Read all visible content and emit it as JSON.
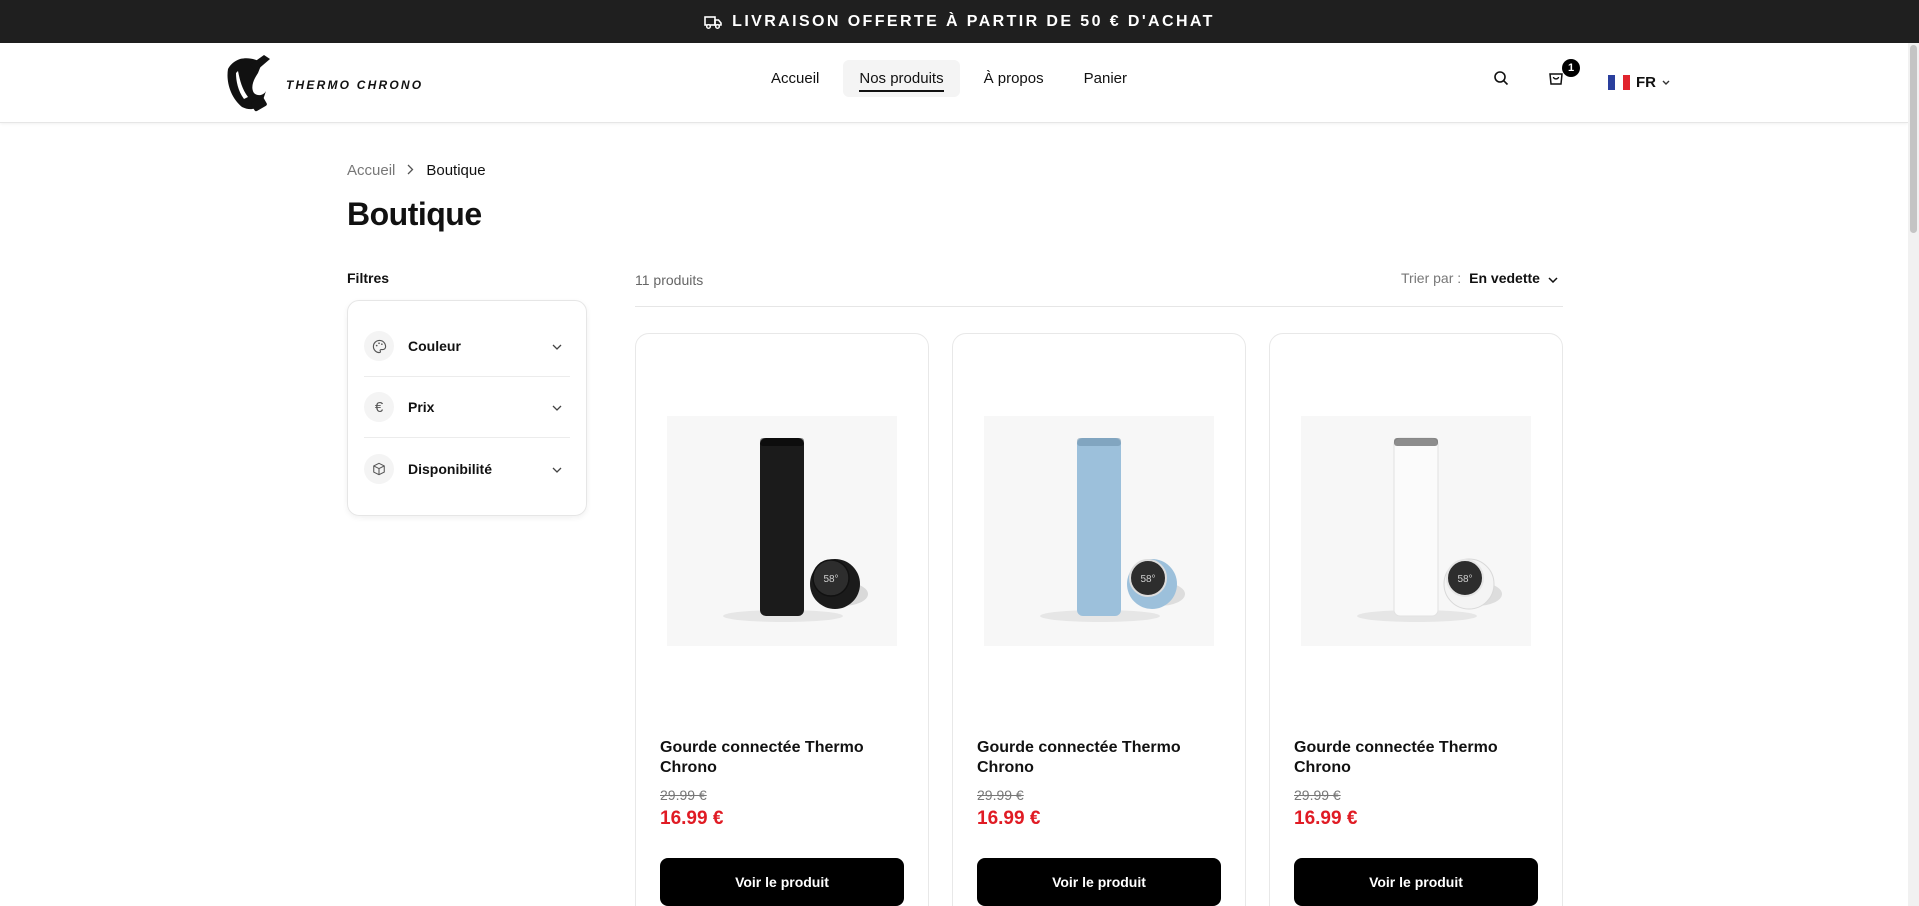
{
  "announcement": {
    "text": "LIVRAISON OFFERTE À PARTIR DE 50 € D'ACHAT",
    "icon": "truck-icon"
  },
  "header": {
    "logo_text": "THERMO CHRONO",
    "nav": [
      {
        "label": "Accueil",
        "active": false
      },
      {
        "label": "Nos produits",
        "active": true
      },
      {
        "label": "À propos",
        "active": false
      },
      {
        "label": "Panier",
        "active": false
      }
    ],
    "cart_count": "1",
    "language": "FR"
  },
  "breadcrumb": {
    "home": "Accueil",
    "current": "Boutique"
  },
  "page_title": "Boutique",
  "filters": {
    "heading": "Filtres",
    "items": [
      {
        "label": "Couleur",
        "icon": "palette-icon"
      },
      {
        "label": "Prix",
        "icon": "euro-icon"
      },
      {
        "label": "Disponibilité",
        "icon": "box-icon"
      }
    ]
  },
  "toolbar": {
    "count": "11 produits",
    "sort_label": "Trier par :",
    "sort_value": "En vedette"
  },
  "products": [
    {
      "title": "Gourde connectée Thermo Chrono",
      "old_price": "29.99 €",
      "price": "16.99 €",
      "button": "Voir le produit",
      "color": "#1b1b1b",
      "display": "58°"
    },
    {
      "title": "Gourde connectée Thermo Chrono",
      "old_price": "29.99 €",
      "price": "16.99 €",
      "button": "Voir le produit",
      "color": "#9cc0db",
      "display": "58°"
    },
    {
      "title": "Gourde connectée Thermo Chrono",
      "old_price": "29.99 €",
      "price": "16.99 €",
      "button": "Voir le produit",
      "color": "#f4f4f4",
      "display": "58°"
    }
  ],
  "colors": {
    "accent_price": "#e01b24",
    "button": "#000000",
    "announcement_bg": "#1f1f1f"
  }
}
